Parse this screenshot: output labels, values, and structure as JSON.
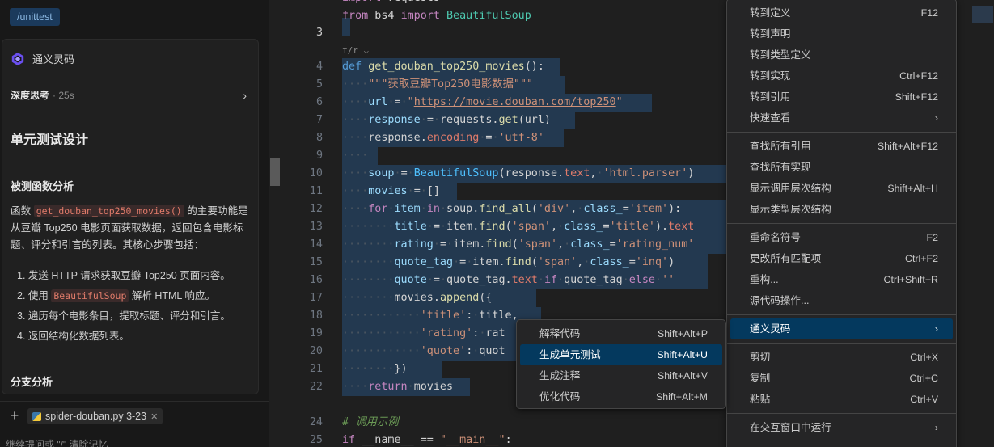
{
  "chat": {
    "path_chip": "/unittest",
    "assistant_name": "通义灵码",
    "deep_think_label": "深度思考",
    "deep_think_duration": "· 25s",
    "heading": "单元测试设计",
    "section1": "被测函数分析",
    "para_prefix": "函数 ",
    "para_code": "get_douban_top250_movies()",
    "para_suffix": " 的主要功能是从豆瓣 Top250 电影页面获取数据，返回包含电影标题、评分和引言的列表。其核心步骤包括：",
    "steps": [
      "1. 发送 HTTP 请求获取豆瓣 Top250 页面内容。",
      "2. 使用 ",
      "3. 遍历每个电影条目，提取标题、评分和引言。",
      "4. 返回结构化数据列表。"
    ],
    "step2_code": "BeautifulSoup",
    "step2_suffix": " 解析 HTML 响应。",
    "section2": "分支分析",
    "file_chip": "spider-douban.py 3-23",
    "prompt_placeholder": "继续提问或 \"/\" 清除记忆"
  },
  "editor": {
    "line_numbers": [
      "",
      "",
      "3",
      "",
      "4",
      "5",
      "6",
      "7",
      "8",
      "9",
      "10",
      "11",
      "12",
      "13",
      "14",
      "15",
      "16",
      "17",
      "18",
      "19",
      "20",
      "21",
      "22",
      "23",
      "24",
      "25"
    ],
    "codelens": "ɪ/r ⌵"
  },
  "context_menu": {
    "items": [
      {
        "label": "转到定义",
        "key": "F12"
      },
      {
        "label": "转到声明",
        "key": ""
      },
      {
        "label": "转到类型定义",
        "key": ""
      },
      {
        "label": "转到实现",
        "key": "Ctrl+F12"
      },
      {
        "label": "转到引用",
        "key": "Shift+F12"
      },
      {
        "label": "快速查看",
        "key": "›"
      },
      {
        "label": "查找所有引用",
        "key": "Shift+Alt+F12"
      },
      {
        "label": "查找所有实现",
        "key": ""
      },
      {
        "label": "显示调用层次结构",
        "key": "Shift+Alt+H"
      },
      {
        "label": "显示类型层次结构",
        "key": ""
      },
      {
        "label": "重命名符号",
        "key": "F2"
      },
      {
        "label": "更改所有匹配项",
        "key": "Ctrl+F2"
      },
      {
        "label": "重构...",
        "key": "Ctrl+Shift+R"
      },
      {
        "label": "源代码操作...",
        "key": ""
      },
      {
        "label": "通义灵码",
        "key": "›"
      },
      {
        "label": "剪切",
        "key": "Ctrl+X"
      },
      {
        "label": "复制",
        "key": "Ctrl+C"
      },
      {
        "label": "粘贴",
        "key": "Ctrl+V"
      },
      {
        "label": "在交互窗口中运行",
        "key": "›"
      }
    ]
  },
  "submenu": {
    "items": [
      {
        "label": "解释代码",
        "key": "Shift+Alt+P"
      },
      {
        "label": "生成单元测试",
        "key": "Shift+Alt+U"
      },
      {
        "label": "生成注释",
        "key": "Shift+Alt+V"
      },
      {
        "label": "优化代码",
        "key": "Shift+Alt+M"
      }
    ]
  },
  "colors": {
    "selection": "#264f78",
    "menu_active": "#04395e",
    "accent": "#569cd6"
  }
}
